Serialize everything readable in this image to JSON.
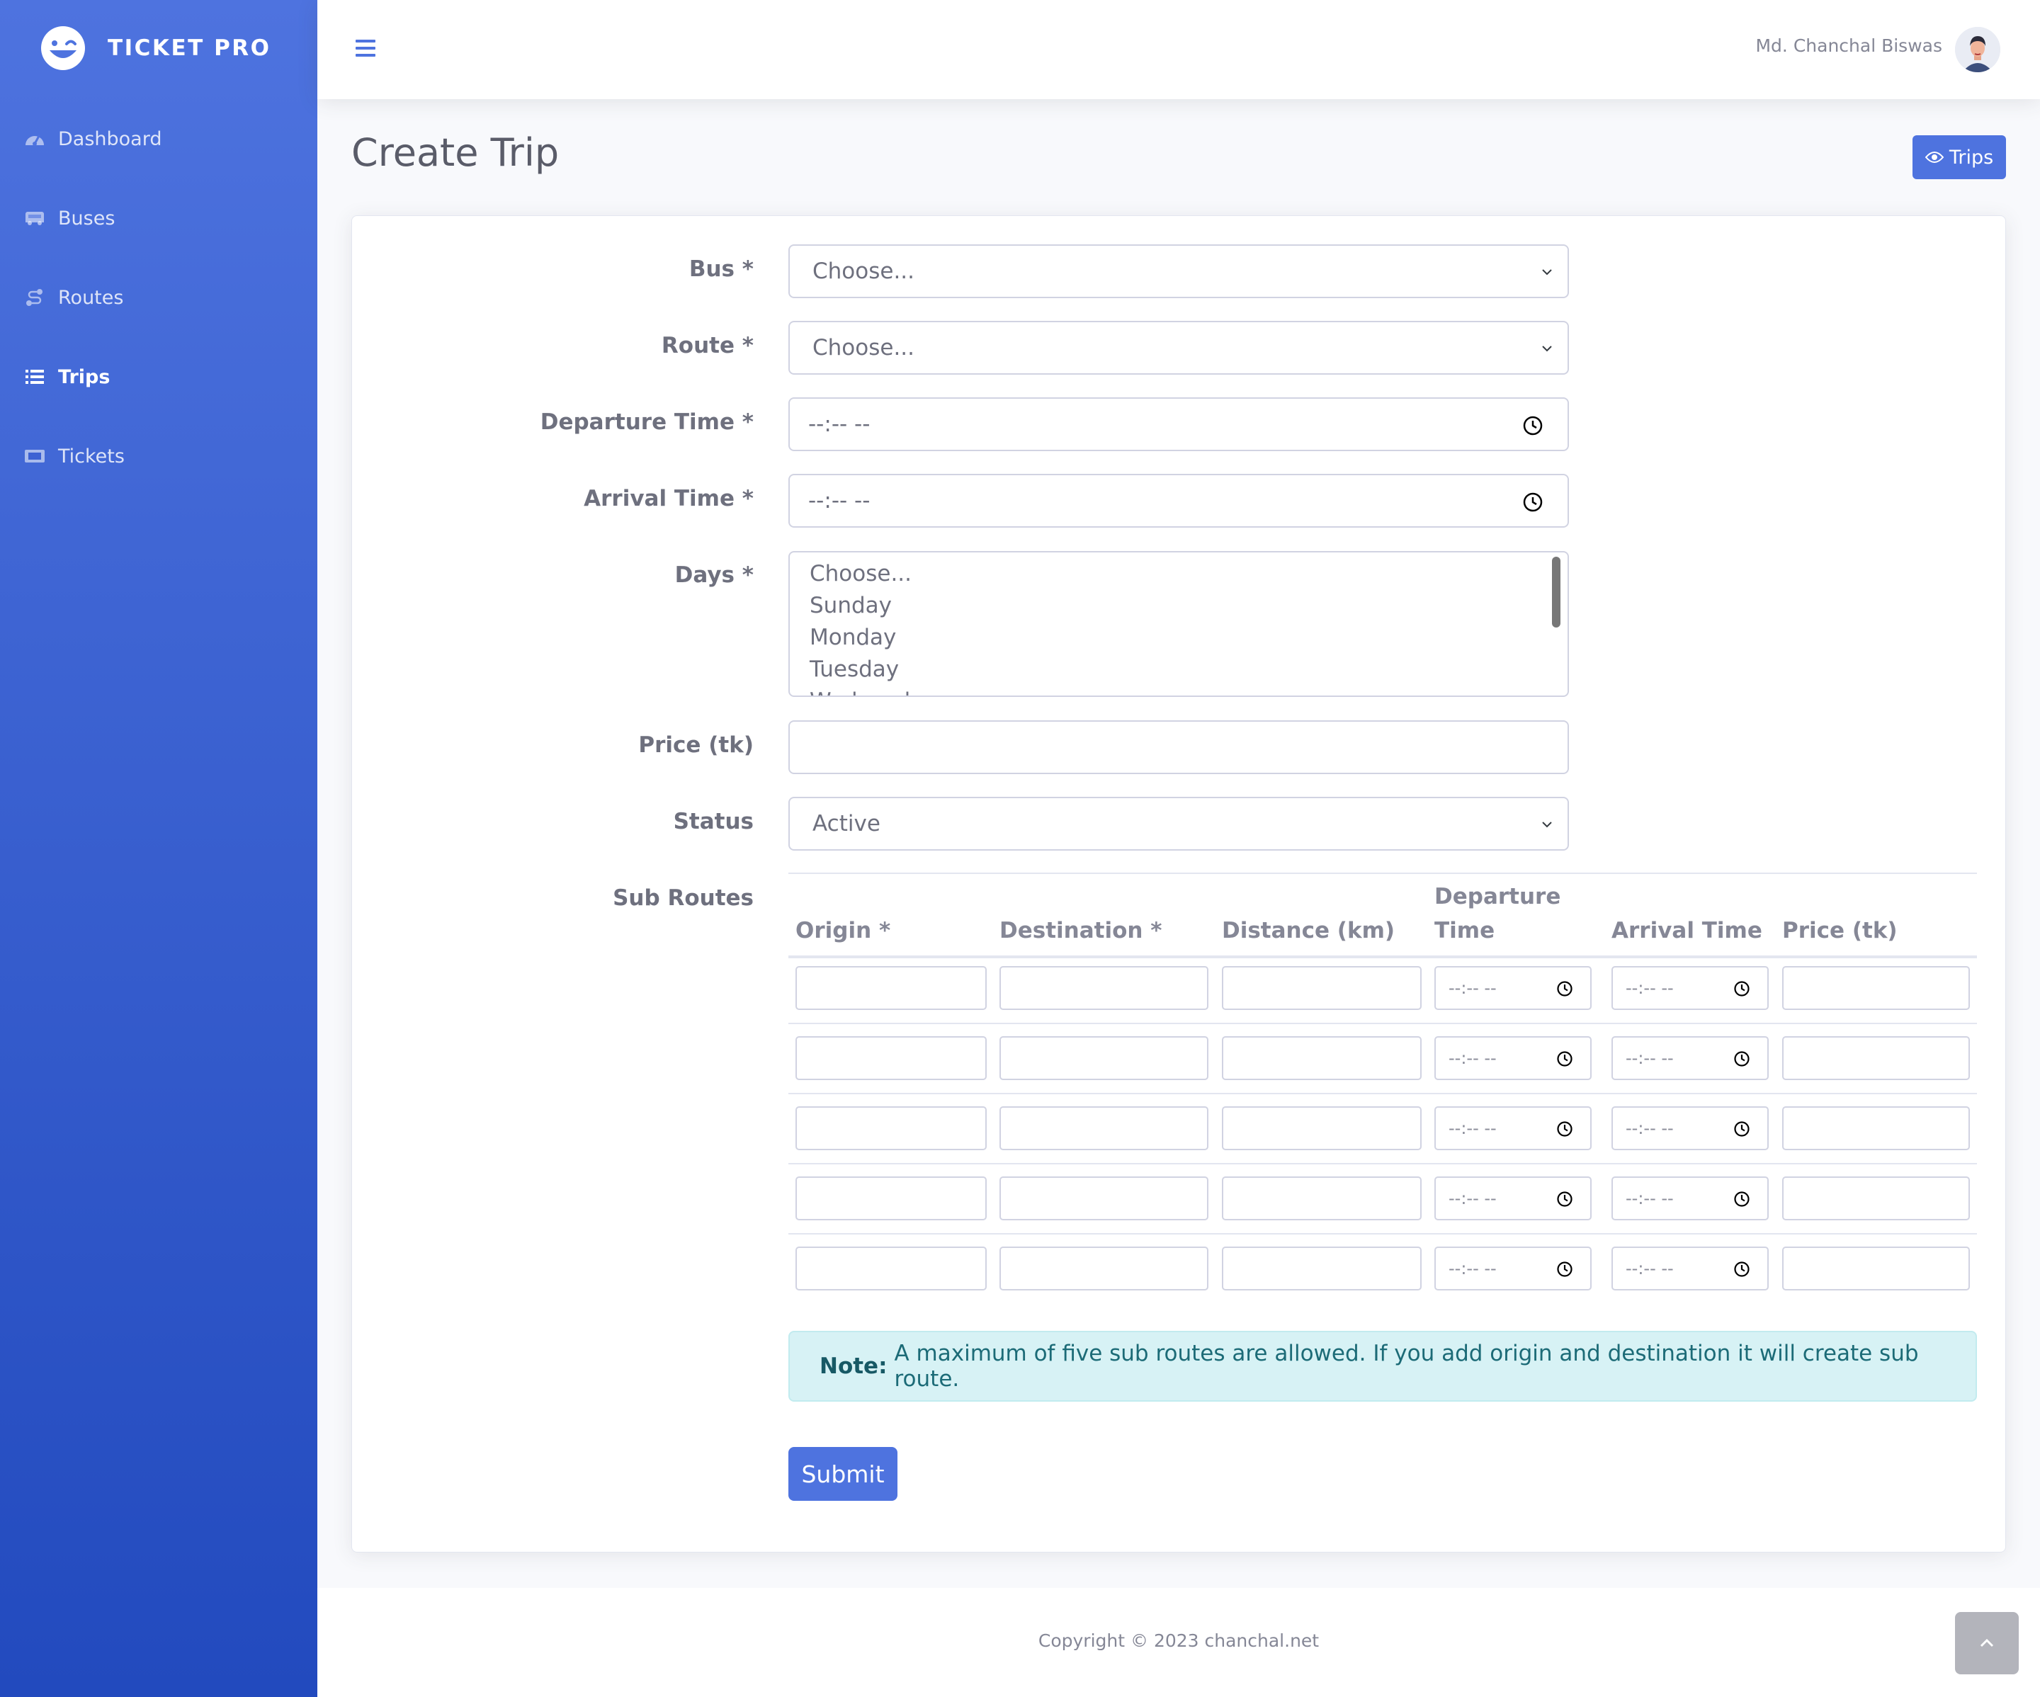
{
  "brand": {
    "name": "TICKET PRO"
  },
  "sidebar": {
    "items": [
      {
        "label": "Dashboard",
        "icon": "tachometer-icon"
      },
      {
        "label": "Buses",
        "icon": "bus-icon"
      },
      {
        "label": "Routes",
        "icon": "route-icon"
      },
      {
        "label": "Trips",
        "icon": "list-icon",
        "active": true
      },
      {
        "label": "Tickets",
        "icon": "ticket-icon"
      }
    ]
  },
  "topbar": {
    "user_name": "Md. Chanchal Biswas"
  },
  "page": {
    "title": "Create Trip",
    "trips_button": "Trips"
  },
  "form": {
    "bus": {
      "label": "Bus *",
      "value": "Choose..."
    },
    "route": {
      "label": "Route *",
      "value": "Choose..."
    },
    "departure_time": {
      "label": "Departure Time *",
      "value": "--:-- --"
    },
    "arrival_time": {
      "label": "Arrival Time *",
      "value": "--:-- --"
    },
    "days": {
      "label": "Days *",
      "options": [
        "Choose...",
        "Sunday",
        "Monday",
        "Tuesday",
        "Wednesday"
      ]
    },
    "price": {
      "label": "Price (tk)",
      "value": ""
    },
    "status": {
      "label": "Status",
      "value": "Active"
    },
    "sub_routes": {
      "label": "Sub Routes",
      "headers": [
        "Origin *",
        "Destination *",
        "Distance (km)",
        "Departure Time",
        "Arrival Time",
        "Price (tk)"
      ],
      "time_placeholder": "--:-- --",
      "row_count": 5
    },
    "note": {
      "strong": "Note:",
      "text": "A maximum of five sub routes are allowed. If you add origin and destination it will create sub route."
    },
    "submit_label": "Submit"
  },
  "footer": {
    "copyright": "Copyright © 2023 chanchal.net"
  },
  "colors": {
    "primary": "#4e73df",
    "sidebar_end": "#224abe",
    "info_bg": "#d7f2f5",
    "info_text": "#1c6b77"
  }
}
